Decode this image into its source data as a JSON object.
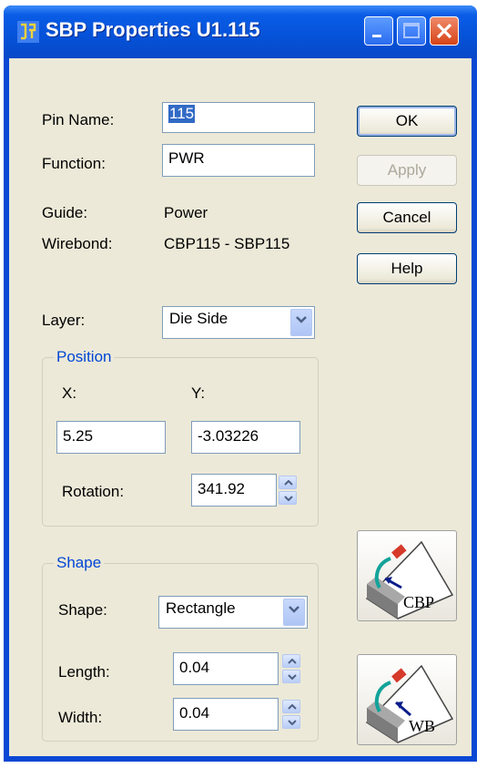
{
  "window": {
    "title": "SBP Properties U1.115",
    "minimize_icon": "minimize-icon",
    "maximize_icon": "maximize-icon",
    "close_icon": "close-icon"
  },
  "form": {
    "pin_name_label": "Pin Name:",
    "pin_name_value": "115",
    "function_label": "Function:",
    "function_value": "PWR",
    "guide_label": "Guide:",
    "guide_value": "Power",
    "wirebond_label": "Wirebond:",
    "wirebond_value": "CBP115 - SBP115",
    "layer_label": "Layer:",
    "layer_value": "Die Side"
  },
  "buttons": {
    "ok": "OK",
    "apply": "Apply",
    "cancel": "Cancel",
    "help": "Help",
    "cbp": "CBP",
    "wb": "WB"
  },
  "position": {
    "group_title": "Position",
    "x_label": "X:",
    "y_label": "Y:",
    "x_value": "5.25",
    "y_value": "-3.03226",
    "rotation_label": "Rotation:",
    "rotation_value": "341.92"
  },
  "shape": {
    "group_title": "Shape",
    "shape_label": "Shape:",
    "shape_value": "Rectangle",
    "length_label": "Length:",
    "length_value": "0.04",
    "width_label": "Width:",
    "width_value": "0.04"
  },
  "colors": {
    "titlebar": "#0552d8",
    "dialog_face": "#ece9d8",
    "group_title": "#0046d5",
    "selection": "#316ac5"
  }
}
